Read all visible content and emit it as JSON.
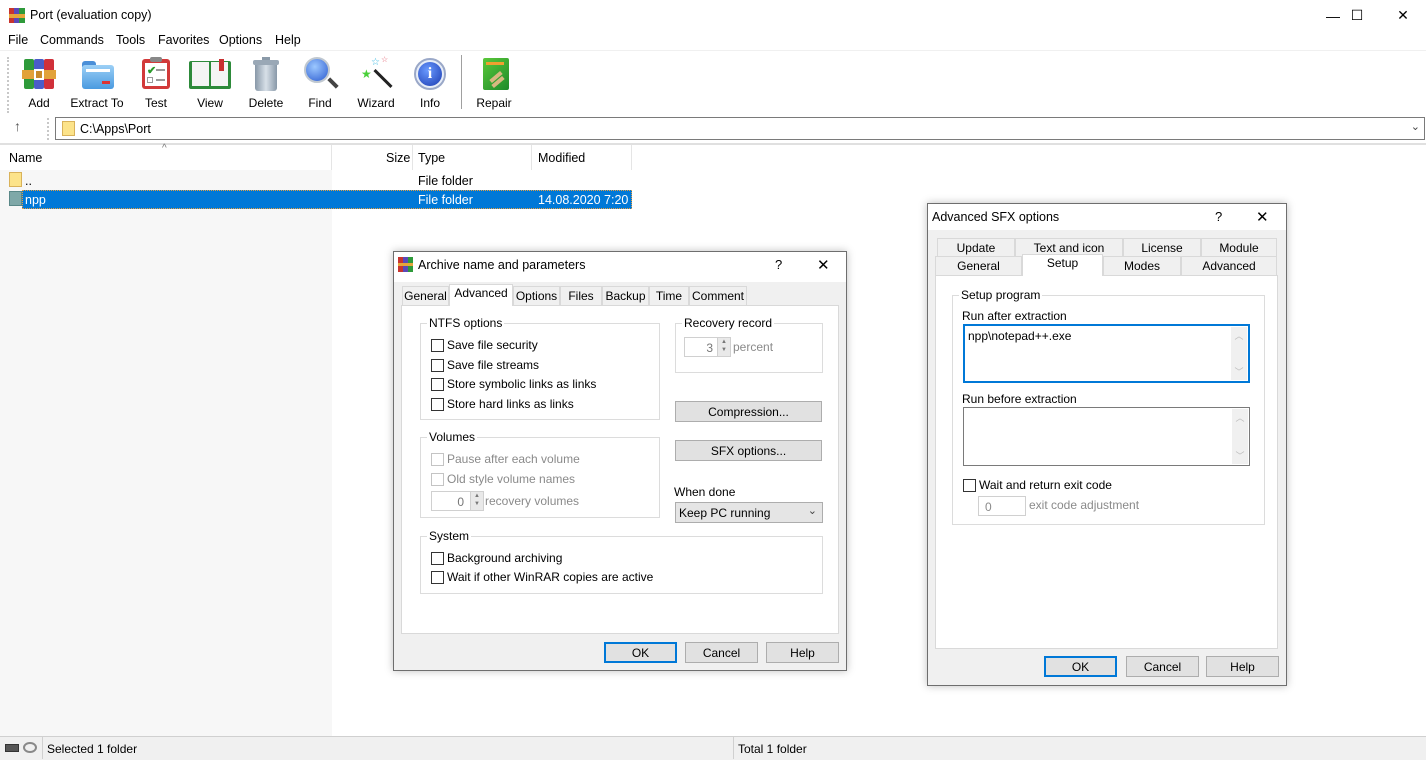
{
  "window": {
    "title": "Port (evaluation copy)",
    "controls": {
      "minimize": "—",
      "maximize": "☐",
      "close": "✕"
    }
  },
  "menu": [
    "File",
    "Commands",
    "Tools",
    "Favorites",
    "Options",
    "Help"
  ],
  "toolbar": [
    {
      "label": "Add",
      "icon": "add-archive-icon"
    },
    {
      "label": "Extract To",
      "icon": "extract-folder-icon"
    },
    {
      "label": "Test",
      "icon": "test-clipboard-icon"
    },
    {
      "label": "View",
      "icon": "view-book-icon"
    },
    {
      "label": "Delete",
      "icon": "trash-icon"
    },
    {
      "label": "Find",
      "icon": "magnifier-icon"
    },
    {
      "label": "Wizard",
      "icon": "magic-wand-icon"
    },
    {
      "label": "Info",
      "icon": "info-icon"
    },
    {
      "label": "Repair",
      "icon": "repair-icon"
    }
  ],
  "address": {
    "path": "C:\\Apps\\Port",
    "up_icon": "↑",
    "dropdown_icon": "⌄"
  },
  "filelist": {
    "columns": [
      "Name",
      "Size",
      "Type",
      "Modified"
    ],
    "sort_indicator": "^",
    "rows": [
      {
        "name": "..",
        "size": "",
        "type": "File folder",
        "modified": ""
      },
      {
        "name": "npp",
        "size": "",
        "type": "File folder",
        "modified": "14.08.2020 7:20",
        "selected": true
      }
    ]
  },
  "status": {
    "left": "Selected 1 folder",
    "right": "Total 1 folder"
  },
  "archive_dialog": {
    "title": "Archive name and parameters",
    "help": "?",
    "close": "✕",
    "tabs": [
      "General",
      "Advanced",
      "Options",
      "Files",
      "Backup",
      "Time",
      "Comment"
    ],
    "active_tab": "Advanced",
    "ntfs": {
      "label": "NTFS options",
      "items": [
        "Save file security",
        "Save file streams",
        "Store symbolic links as links",
        "Store hard links as links"
      ]
    },
    "recovery": {
      "label": "Recovery record",
      "value": "3",
      "unit": "percent"
    },
    "compression_btn": "Compression...",
    "sfx_btn": "SFX options...",
    "volumes": {
      "label": "Volumes",
      "items": [
        "Pause after each volume",
        "Old style volume names"
      ],
      "recovery_value": "0",
      "recovery_unit": "recovery volumes"
    },
    "when_done": {
      "label": "When done",
      "value": "Keep PC running"
    },
    "system": {
      "label": "System",
      "items": [
        "Background archiving",
        "Wait if other WinRAR copies are active"
      ]
    },
    "buttons": {
      "ok": "OK",
      "cancel": "Cancel",
      "help": "Help"
    }
  },
  "sfx_dialog": {
    "title": "Advanced SFX options",
    "help": "?",
    "close": "✕",
    "tabs_row1": [
      "Update",
      "Text and icon",
      "License",
      "Module"
    ],
    "tabs_row2": [
      "General",
      "Setup",
      "Modes",
      "Advanced"
    ],
    "active_tab": "Setup",
    "group": "Setup program",
    "run_after": {
      "label": "Run after extraction",
      "value": "npp\\notepad++.exe"
    },
    "run_before": {
      "label": "Run before extraction",
      "value": ""
    },
    "wait": {
      "label": "Wait and return exit code"
    },
    "exit_adj": {
      "value": "0",
      "label": "exit code adjustment"
    },
    "buttons": {
      "ok": "OK",
      "cancel": "Cancel",
      "help": "Help"
    }
  }
}
